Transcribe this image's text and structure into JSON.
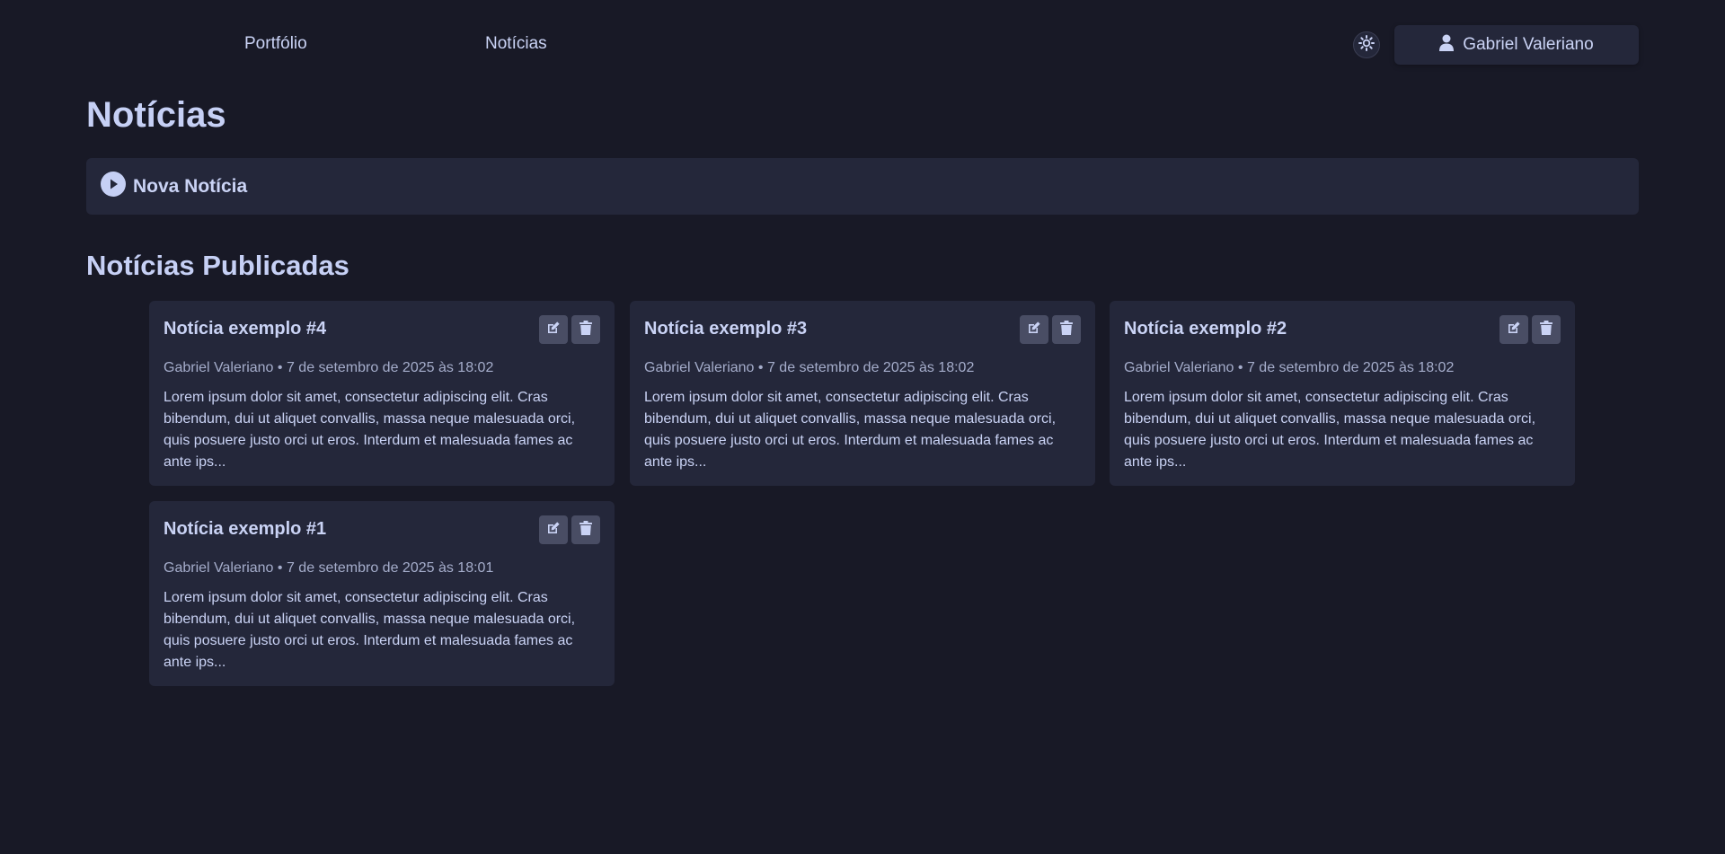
{
  "nav": {
    "portfolio": "Portfólio",
    "news": "Notícias"
  },
  "theme_toggle": {
    "icon": "sun-icon"
  },
  "user": {
    "name": "Gabriel Valeriano",
    "icon": "user-icon"
  },
  "page": {
    "title": "Notícias",
    "new_news_label": "Nova Notícia",
    "published_title": "Notícias Publicadas"
  },
  "posts": [
    {
      "title": "Notícia exemplo #4",
      "author": "Gabriel Valeriano",
      "separator": "•",
      "date": "7 de setembro de 2025 às 18:02",
      "excerpt": "Lorem ipsum dolor sit amet, consectetur adipiscing elit. Cras bibendum, dui ut aliquet convallis, massa neque malesuada orci, quis posuere justo orci ut eros. Interdum et malesuada fames ac ante ips..."
    },
    {
      "title": "Notícia exemplo #3",
      "author": "Gabriel Valeriano",
      "separator": "•",
      "date": "7 de setembro de 2025 às 18:02",
      "excerpt": "Lorem ipsum dolor sit amet, consectetur adipiscing elit. Cras bibendum, dui ut aliquet convallis, massa neque malesuada orci, quis posuere justo orci ut eros. Interdum et malesuada fames ac ante ips..."
    },
    {
      "title": "Notícia exemplo #2",
      "author": "Gabriel Valeriano",
      "separator": "•",
      "date": "7 de setembro de 2025 às 18:02",
      "excerpt": "Lorem ipsum dolor sit amet, consectetur adipiscing elit. Cras bibendum, dui ut aliquet convallis, massa neque malesuada orci, quis posuere justo orci ut eros. Interdum et malesuada fames ac ante ips..."
    },
    {
      "title": "Notícia exemplo #1",
      "author": "Gabriel Valeriano",
      "separator": "•",
      "date": "7 de setembro de 2025 às 18:01",
      "excerpt": "Lorem ipsum dolor sit amet, consectetur adipiscing elit. Cras bibendum, dui ut aliquet convallis, massa neque malesuada orci, quis posuere justo orci ut eros. Interdum et malesuada fames ac ante ips..."
    }
  ],
  "colors": {
    "background": "#181926",
    "surface": "#24273a",
    "text": "#cad3f5",
    "muted": "#a5adcb",
    "button": "#494d64"
  }
}
